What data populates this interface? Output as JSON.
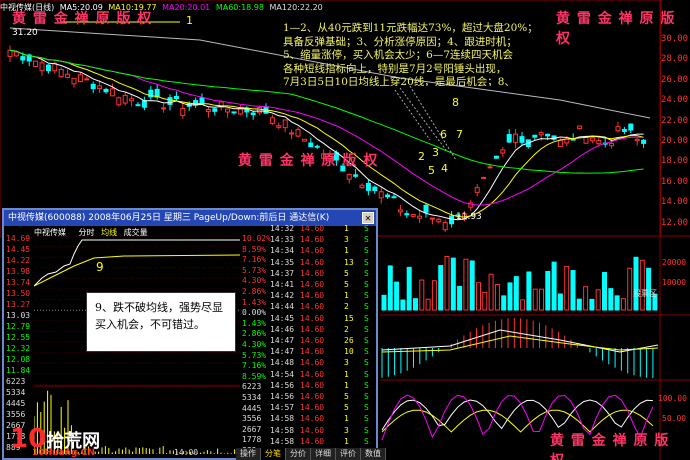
{
  "topbar": {
    "title": "中视传媒(日线)",
    "ma5": "MA5:20.09",
    "ma10": "MA10:19.77",
    "ma20": "MA20:20.01",
    "ma60": "MA60:18.98",
    "ma120": "MA120:22.20"
  },
  "price_axis": [
    "30.00",
    "28.00",
    "26.00",
    "24.00",
    "22.00",
    "20.00",
    "18.00",
    "16.00",
    "14.00",
    "12.00"
  ],
  "chart_labels": {
    "high": "31.20",
    "low": "11.93",
    "n1": "1",
    "n2": "2",
    "n3": "3",
    "n4": "4",
    "n5": "5",
    "n6": "6",
    "n7": "7",
    "n8": "8"
  },
  "annotation": "1—2、从40元跌到11元跌幅达73%，超过大盘20%；\n具备反弹基础；3、分析涨停原因；4、跟进时机；\n5、缩量涨停，买入机会太少；6—7连续四天机会\n各种短线指标向上，特别是7月2号阳锤头出现，\n7月3日5日10日均线上穿20线，是最后机会；8、\n大盘形势不好速战速决，赢利20——30出局。",
  "watermark": "黄   雷   金   禅   原   版   权",
  "vol_axis": [
    "20000",
    "10000"
  ],
  "vol_label": "股票区",
  "macd_axis": [],
  "kdj_axis": [
    "100.00",
    "50.00"
  ],
  "popup": {
    "title": "中视传媒(600088)  2008年06月25日  星期三  PageUp/Down:前后日  通达信(K)",
    "head_name": "中视传媒",
    "head_tab": "分时",
    "head_avg": "均线",
    "head_vol": "成交量",
    "left_prices": [
      "14.69",
      "14.45",
      "14.22",
      "13.98",
      "13.74",
      "13.50",
      "13.27",
      "13.03",
      "12.79",
      "12.55",
      "12.32",
      "12.08",
      "11.84",
      "6223",
      "5334",
      "4445",
      "3556",
      "2667",
      "1778",
      "889"
    ],
    "right_pcts": [
      "10.02%",
      "8.59%",
      "7.16%",
      "5.73%",
      "4.30%",
      "2.86%",
      "1.43%",
      "0.00%",
      "1.43%",
      "2.86%",
      "4.30%",
      "5.73%",
      "7.16%",
      "8.59%",
      "6223",
      "5334",
      "4445",
      "3556",
      "2667",
      "1778",
      "889"
    ],
    "time_label": "14:00",
    "trades": [
      {
        "t": "14:32",
        "p": "14.60",
        "v": "1",
        "s": "S"
      },
      {
        "t": "14:33",
        "p": "14.60",
        "v": "3",
        "s": "S"
      },
      {
        "t": "14:34",
        "p": "14.60",
        "v": "1",
        "s": "S"
      },
      {
        "t": "14:35",
        "p": "14.60",
        "v": "13",
        "s": "S"
      },
      {
        "t": "14:37",
        "p": "14.60",
        "v": "5",
        "s": "S"
      },
      {
        "t": "14:41",
        "p": "14.60",
        "v": "5",
        "s": "S"
      },
      {
        "t": "14:42",
        "p": "14.60",
        "v": "1",
        "s": "S"
      },
      {
        "t": "14:44",
        "p": "14.60",
        "v": "2",
        "s": "S"
      },
      {
        "t": "14:45",
        "p": "14.60",
        "v": "15",
        "s": "S"
      },
      {
        "t": "14:46",
        "p": "14.60",
        "v": "2",
        "s": "S"
      },
      {
        "t": "14:47",
        "p": "14.60",
        "v": "26",
        "s": "S"
      },
      {
        "t": "14:47",
        "p": "14.60",
        "v": "10",
        "s": "S"
      },
      {
        "t": "14:48",
        "p": "14.60",
        "v": "3",
        "s": "S"
      },
      {
        "t": "14:54",
        "p": "14.60",
        "v": "1",
        "s": "S"
      },
      {
        "t": "14:56",
        "p": "14.60",
        "v": "1",
        "s": "S"
      },
      {
        "t": "14:56",
        "p": "14.60",
        "v": "5",
        "s": "S"
      },
      {
        "t": "14:57",
        "p": "14.60",
        "v": "5",
        "s": "S"
      },
      {
        "t": "14:58",
        "p": "14.60",
        "v": "1",
        "s": "S"
      },
      {
        "t": "14:58",
        "p": "14.60",
        "v": "3",
        "s": "S"
      },
      {
        "t": "14:58",
        "p": "14.60",
        "v": "1",
        "s": "S"
      },
      {
        "t": "14:58",
        "p": "14.60",
        "v": "50",
        "s": "S"
      }
    ],
    "note_num": "9",
    "note_text1": "9、跌不破均线，强势尽显",
    "note_text2": "买入机会，不可错过。"
  },
  "tabs": [
    "操作",
    "分笔",
    "分价",
    "详细",
    "评价",
    "数值"
  ],
  "logo": {
    "num": "10",
    "text": "拾荒网",
    "sub": "10Huang.CN"
  },
  "colors": {
    "up": "#ff3333",
    "down": "#00ffff",
    "ma_white": "#ffffff",
    "ma_yellow": "#ffff00",
    "ma_purple": "#ff00ff",
    "ma_green": "#00ff00"
  }
}
